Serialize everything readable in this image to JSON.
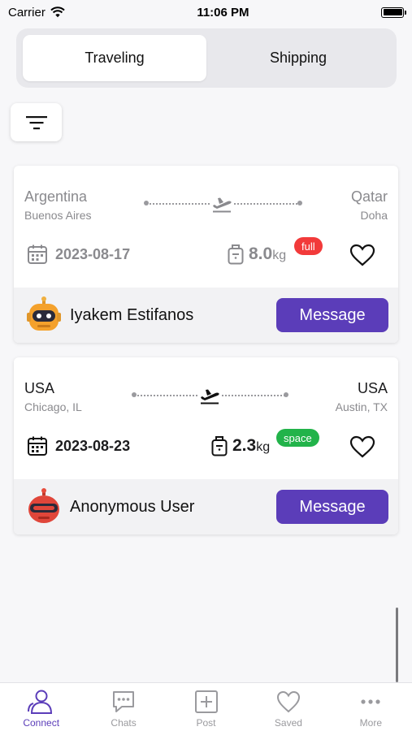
{
  "status_bar": {
    "carrier": "Carrier",
    "time": "11:06 PM"
  },
  "segment": {
    "tabs": [
      {
        "label": "Traveling",
        "active": true
      },
      {
        "label": "Shipping",
        "active": false
      }
    ]
  },
  "trips": [
    {
      "from_country": "Argentina",
      "from_city": "Buenos Aires",
      "to_country": "Qatar",
      "to_city": "Doha",
      "date": "2023-08-17",
      "weight": "8.0",
      "unit": "kg",
      "tag": "full",
      "tag_color": "#f23a3a",
      "user": "Iyakem Estifanos",
      "message_label": "Message",
      "faded": true
    },
    {
      "from_country": "USA",
      "from_city": "Chicago, IL",
      "to_country": "USA",
      "to_city": "Austin, TX",
      "date": "2023-08-23",
      "weight": "2.3",
      "unit": "kg",
      "tag": "space",
      "tag_color": "#22b34a",
      "user": "Anonymous User",
      "message_label": "Message",
      "faded": false
    }
  ],
  "tab_bar": {
    "items": [
      {
        "label": "Connect",
        "icon": "connect-icon",
        "active": true
      },
      {
        "label": "Chats",
        "icon": "chats-icon",
        "active": false
      },
      {
        "label": "Post",
        "icon": "post-icon",
        "active": false
      },
      {
        "label": "Saved",
        "icon": "saved-icon",
        "active": false
      },
      {
        "label": "More",
        "icon": "more-icon",
        "active": false
      }
    ]
  },
  "colors": {
    "accent": "#5b3db9",
    "full": "#f23a3a",
    "space": "#22b34a"
  }
}
